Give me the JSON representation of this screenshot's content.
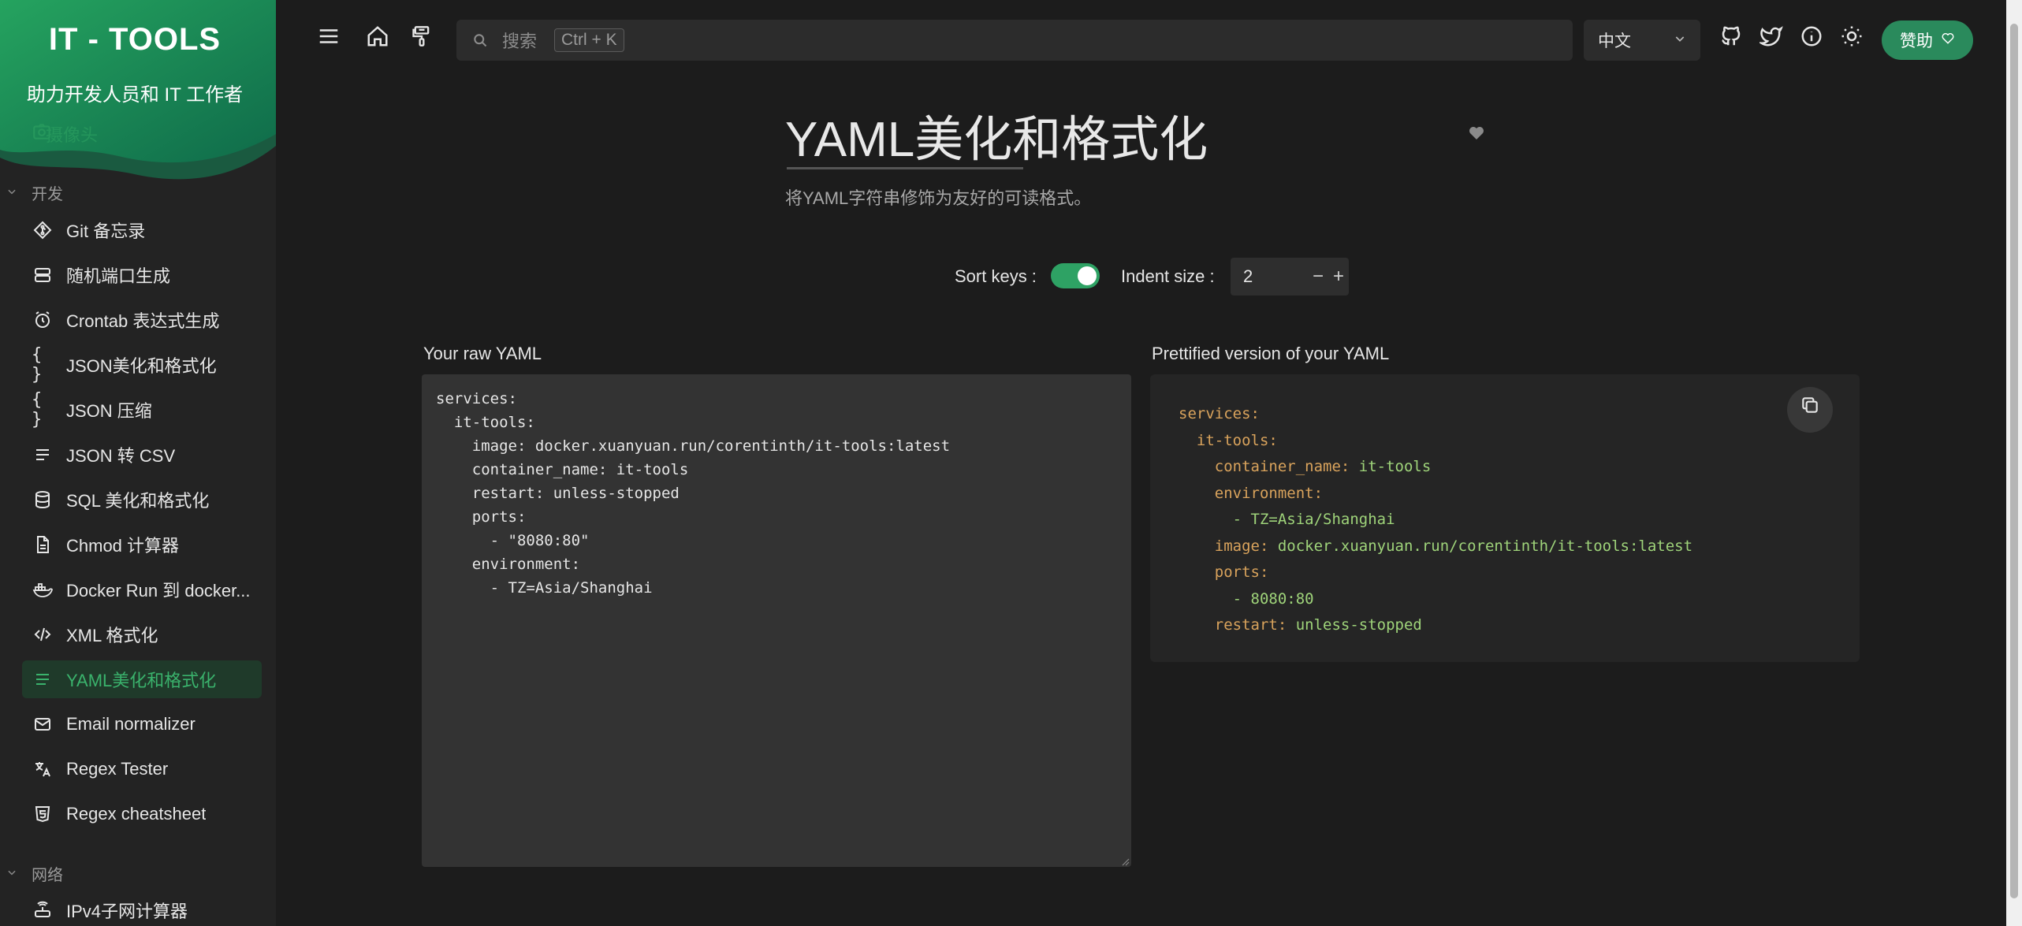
{
  "brand": {
    "title": "IT - TOOLS",
    "subtitle": "助力开发人员和 IT 工作者",
    "peek_label": "摄像头"
  },
  "sidebar": {
    "groups": [
      {
        "label": "开发"
      },
      {
        "label": "网络"
      }
    ],
    "items": [
      {
        "label": "Git 备忘录",
        "icon": "git-icon"
      },
      {
        "label": "随机端口生成",
        "icon": "server-icon"
      },
      {
        "label": "Crontab 表达式生成",
        "icon": "alarm-clock-icon"
      },
      {
        "label": "JSON美化和格式化",
        "icon": "braces-icon"
      },
      {
        "label": "JSON 压缩",
        "icon": "braces-icon"
      },
      {
        "label": "JSON 转 CSV",
        "icon": "list-icon"
      },
      {
        "label": "SQL 美化和格式化",
        "icon": "database-icon"
      },
      {
        "label": "Chmod 计算器",
        "icon": "file-icon"
      },
      {
        "label": "Docker Run 到 docker...",
        "icon": "docker-icon"
      },
      {
        "label": "XML 格式化",
        "icon": "code-icon"
      },
      {
        "label": "YAML美化和格式化",
        "icon": "align-left-icon",
        "active": true
      },
      {
        "label": "Email normalizer",
        "icon": "mail-icon"
      },
      {
        "label": "Regex Tester",
        "icon": "translate-icon"
      },
      {
        "label": "Regex cheatsheet",
        "icon": "html5-icon"
      },
      {
        "label": "IPv4子网计算器",
        "icon": "router-icon"
      }
    ]
  },
  "header": {
    "search_placeholder": "搜索",
    "search_shortcut": "Ctrl + K",
    "language": "中文",
    "sponsor_label": "赞助"
  },
  "tool": {
    "title": "YAML美化和格式化",
    "description": "将YAML字符串修饰为友好的可读格式。",
    "sort_keys_label": "Sort keys :",
    "sort_keys_on": true,
    "indent_label": "Indent size :",
    "indent_value": "2",
    "raw_label": "Your raw YAML",
    "raw_yaml": "services:\n  it-tools:\n    image: docker.xuanyuan.run/corentinth/it-tools:latest\n    container_name: it-tools\n    restart: unless-stopped\n    ports:\n      - \"8080:80\"\n    environment:\n      - TZ=Asia/Shanghai",
    "pretty_label": "Prettified version of your YAML",
    "pretty_lines": [
      {
        "indent": 0,
        "key": "services:",
        "value": ""
      },
      {
        "indent": 1,
        "key": "it-tools:",
        "value": ""
      },
      {
        "indent": 2,
        "key": "container_name:",
        "value": "it-tools"
      },
      {
        "indent": 2,
        "key": "environment:",
        "value": ""
      },
      {
        "indent": 3,
        "key": "",
        "value": "- TZ=Asia/Shanghai"
      },
      {
        "indent": 2,
        "key": "image:",
        "value": "docker.xuanyuan.run/corentinth/it-tools:latest"
      },
      {
        "indent": 2,
        "key": "ports:",
        "value": ""
      },
      {
        "indent": 3,
        "key": "",
        "value": "- 8080:80"
      },
      {
        "indent": 2,
        "key": "restart:",
        "value": "unless-stopped"
      }
    ]
  },
  "colors": {
    "accent": "#2ea264",
    "sidebar_active_bg": "#1f3a2a",
    "yaml_key": "#d9a35c",
    "yaml_value": "#9fd47a"
  }
}
